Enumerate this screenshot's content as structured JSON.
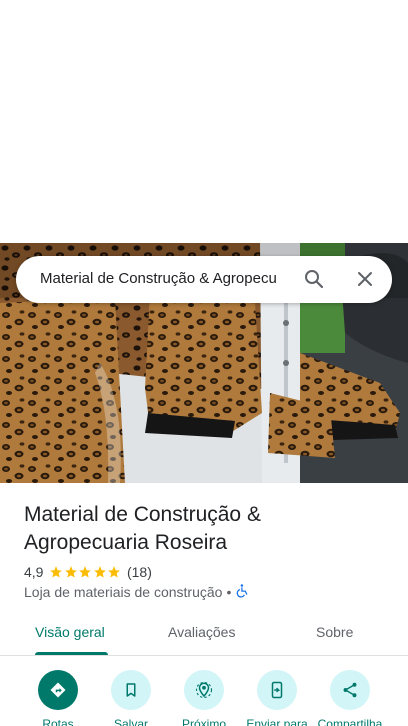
{
  "search": {
    "query": "Material de Construção & Agropecu"
  },
  "place": {
    "title": "Material de Construção & Agropecuaria Roseira",
    "rating": "4,9",
    "stars": 5,
    "review_count": "(18)",
    "category": "Loja de materiais de construção",
    "separator": "•"
  },
  "tabs": [
    {
      "label": "Visão geral",
      "active": true
    },
    {
      "label": "Avaliações",
      "active": false
    },
    {
      "label": "Sobre",
      "active": false
    }
  ],
  "actions": [
    {
      "label": "Rotas",
      "icon": "directions-icon"
    },
    {
      "label": "Salvar",
      "icon": "bookmark-icon"
    },
    {
      "label": "Próximo",
      "icon": "nearby-icon"
    },
    {
      "label": "Enviar para",
      "icon": "send-to-phone-icon"
    },
    {
      "label": "Compartilha",
      "icon": "share-icon"
    }
  ],
  "colors": {
    "accent": "#00796b",
    "action_bg": "#d2f5f7",
    "star": "#fbbc04",
    "accessibility": "#1a73e8"
  }
}
